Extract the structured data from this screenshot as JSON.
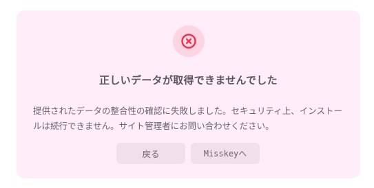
{
  "dialog": {
    "icon": "error-x-circle-icon",
    "title": "正しいデータが取得できませんでした",
    "message": "提供されたデータの整合性の確認に失敗しました。セキュリティ上、インストールは続行できません。サイト管理者にお問い合わせください。",
    "buttons": {
      "back_label": "戻る",
      "misskey_label": "Misskeyへ"
    }
  },
  "colors": {
    "dialog_bg": "#ffedf9",
    "icon_bg": "#fdd4e2",
    "icon_fg": "#e8364f",
    "button_bg": "#f1e0ec",
    "text": "#5c5660"
  }
}
